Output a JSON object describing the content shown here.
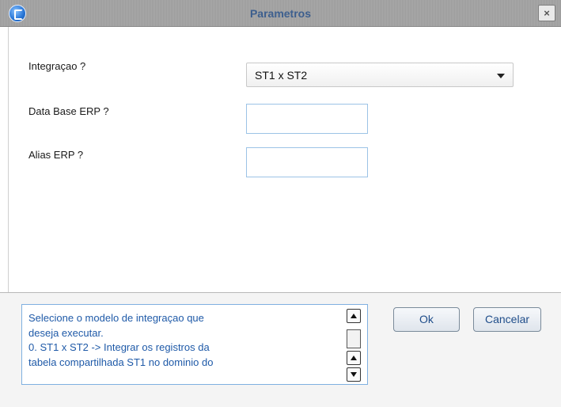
{
  "window": {
    "title": "Parametros",
    "close_label": "×"
  },
  "params": [
    {
      "label": "Integraçao ?",
      "type": "select",
      "value": "ST1 x ST2"
    },
    {
      "label": "Data Base ERP ?",
      "type": "text",
      "value": ""
    },
    {
      "label": "Alias ERP ?",
      "type": "text",
      "value": ""
    }
  ],
  "help": {
    "text": "Selecione o modelo de integraçao que\ndeseja executar.\n0. ST1 x ST2 -> Integrar os registros da\ntabela compartilhada ST1 no dominio do"
  },
  "buttons": {
    "ok": "Ok",
    "cancel": "Cancelar"
  },
  "colors": {
    "title_text": "#3d5f8e",
    "help_text": "#1f5aa8",
    "field_border": "#9cc3e6"
  }
}
